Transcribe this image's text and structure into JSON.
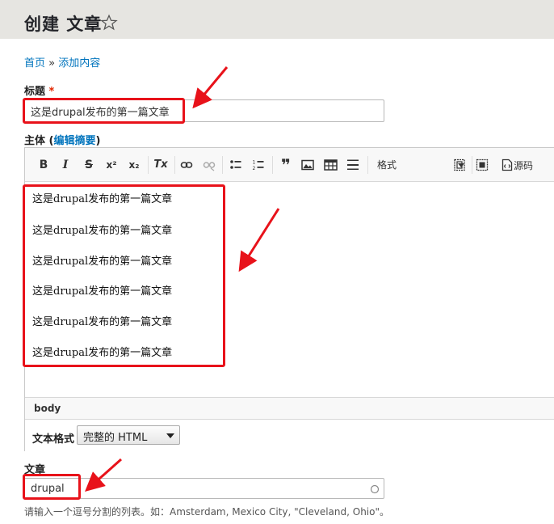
{
  "header": {
    "title": "创建 文章",
    "star_icon": "star-outline-icon"
  },
  "breadcrumb": {
    "home": "首页",
    "separator": "»",
    "current": "添加内容"
  },
  "title_field": {
    "label": "标题",
    "required_mark": "*",
    "value": "这是drupal发布的第一篇文章"
  },
  "body_field": {
    "label": "主体",
    "summary_open": "(",
    "summary_link": "编辑摘要",
    "summary_close": ")",
    "toolbar": {
      "bold": "B",
      "italic": "I",
      "strike": "S",
      "superscript": "x²",
      "subscript": "x₂",
      "remove_format": "Tx",
      "link_icon": "link-icon",
      "unlink_icon": "unlink-icon",
      "bulleted_list_icon": "bulleted-list-icon",
      "numbered_list_icon": "numbered-list-icon",
      "blockquote": "❞",
      "image_icon": "image-icon",
      "table_icon": "table-icon",
      "hr_icon": "horizontal-rule-icon",
      "format_combo": "格式",
      "source_label": "源码"
    },
    "paragraphs": [
      "这是drupal发布的第一篇文章",
      "这是drupal发布的第一篇文章",
      "这是drupal发布的第一篇文章",
      "这是drupal发布的第一篇文章",
      "这是drupal发布的第一篇文章",
      "这是drupal发布的第一篇文章"
    ],
    "path_label": "body",
    "text_format_label": "文本格式",
    "text_format_value": "完整的 HTML"
  },
  "tags_field": {
    "label": "文章",
    "value": "drupal",
    "help": "请输入一个逗号分割的列表。如：Amsterdam, Mexico City, \"Cleveland, Ohio\"。"
  },
  "colors": {
    "accent": "#0074bd",
    "annotation": "#e8121a",
    "header_bg": "#e6e5e1"
  }
}
